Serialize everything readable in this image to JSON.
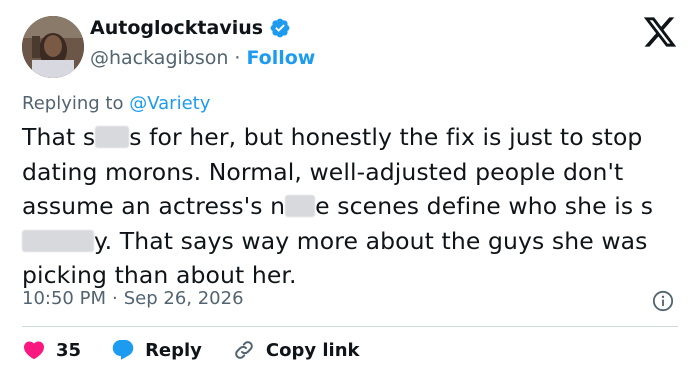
{
  "author": {
    "display_name": "Autoglocktavius",
    "handle": "@hackagibson",
    "separator": "·",
    "follow_label": "Follow",
    "verified_icon": "verified-badge-icon",
    "avatar_icon": "avatar"
  },
  "brand": {
    "logo": "x-logo-icon",
    "accent_color": "#1d9bf0",
    "like_color": "#f91880"
  },
  "reply_context": {
    "prefix": "Replying to",
    "mention": "@Variety"
  },
  "tweet": {
    "t1": "That s",
    "t2": "s for her, but honestly the fix is just to stop dating morons. Normal, well-adjusted people don't assume an actress's n",
    "t3": "e scenes define who she is s",
    "t4": "y. That says way more about the guys she was picking than about her."
  },
  "meta": {
    "time": "10:50 PM",
    "separator": "·",
    "date": "Sep 26, 2026",
    "info_icon": "info-icon"
  },
  "actions": {
    "like_count": "35",
    "reply_label": "Reply",
    "copy_link_label": "Copy link"
  }
}
